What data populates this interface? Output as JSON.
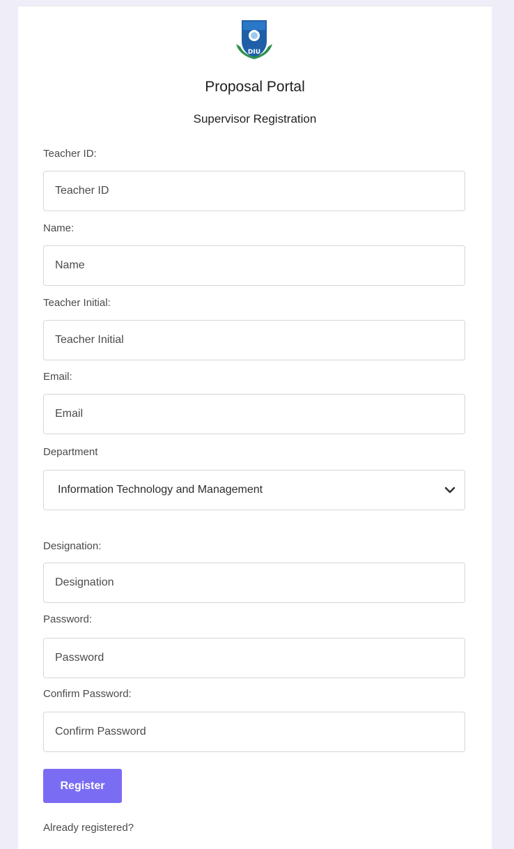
{
  "header": {
    "title": "Proposal Portal",
    "subtitle": "Supervisor Registration",
    "logo_text": "DIU"
  },
  "form": {
    "teacher_id": {
      "label": "Teacher ID:",
      "placeholder": "Teacher ID"
    },
    "name": {
      "label": "Name:",
      "placeholder": "Name"
    },
    "teacher_initial": {
      "label": "Teacher Initial:",
      "placeholder": "Teacher Initial"
    },
    "email": {
      "label": "Email:",
      "placeholder": "Email"
    },
    "department": {
      "label": "Department",
      "selected": "Information Technology and Management"
    },
    "designation": {
      "label": "Designation:",
      "placeholder": "Designation"
    },
    "password": {
      "label": "Password:",
      "placeholder": "Password"
    },
    "confirm_password": {
      "label": "Confirm Password:",
      "placeholder": "Confirm Password"
    },
    "register_label": "Register",
    "already_registered": "Already registered?"
  },
  "colors": {
    "page_background": "#efeef8",
    "button": "#7b6cf4",
    "logo_shield": "#1f5fa8",
    "logo_ribbon": "#2f8f4e"
  }
}
